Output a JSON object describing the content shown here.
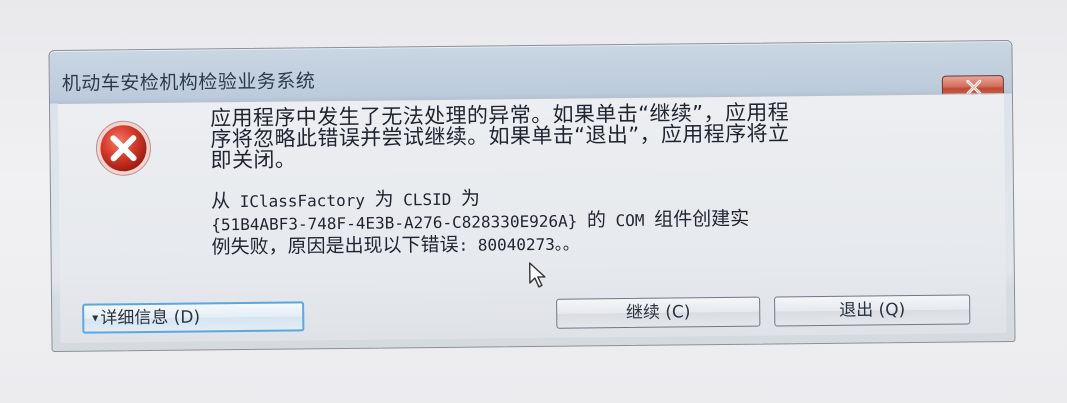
{
  "window": {
    "title": "机动车安检机构检验业务系统"
  },
  "dialog": {
    "message_line1": "应用程序中发生了无法处理的异常。如果单击“继续”，应用程",
    "message_line2": "序将忽略此错误并尝试继续。如果单击“退出”，应用程序将立",
    "message_line3": "即关闭。",
    "detail_line1_cjk_a": "从",
    "detail_line1_mono_a": " IClassFactory ",
    "detail_line1_cjk_b": "为",
    "detail_line1_mono_b": " CLSID ",
    "detail_line1_cjk_c": "为",
    "detail_line2_mono": "{51B4ABF3-748F-4E3B-A276-C828330E926A} ",
    "detail_line2_cjk_a": "的",
    "detail_line2_mono_b": " COM ",
    "detail_line2_cjk_b": "组件创建实",
    "detail_line3_cjk": "例失败，原因是出现以下错误",
    "detail_line3_mono": ": 80040273。。"
  },
  "buttons": {
    "details_caret": "▾",
    "details_label": "详细信息 (D)",
    "continue_label": "继续 (C)",
    "quit_label": "退出 (Q)"
  },
  "icons": {
    "close": "close-icon",
    "error": "error-icon",
    "cursor": "mouse-cursor-icon"
  },
  "colors": {
    "close_button": "#c9533f",
    "error_icon": "#d23a2a",
    "focus_border": "#5da7e0"
  }
}
